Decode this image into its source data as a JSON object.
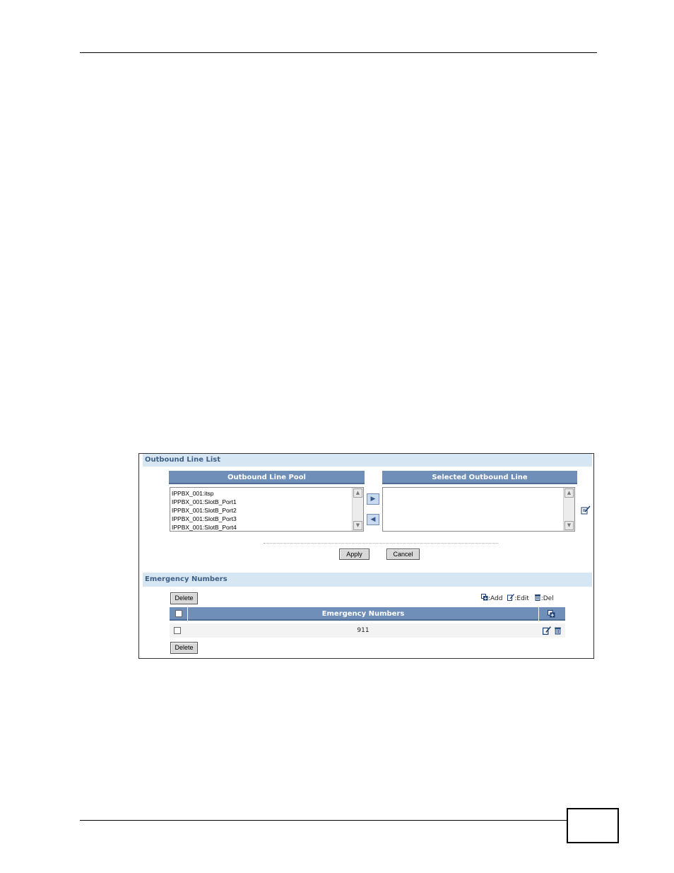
{
  "outbound": {
    "section_title": "Outbound Line List",
    "pool_header": "Outbound Line Pool",
    "selected_header": "Selected Outbound Line",
    "pool_items": [
      "IPPBX_001:itsp",
      "IPPBX_001:SlotB_Port1",
      "IPPBX_001:SlotB_Port2",
      "IPPBX_001:SlotB_Port3",
      "IPPBX_001:SlotB_Port4"
    ],
    "apply_label": "Apply",
    "cancel_label": "Cancel"
  },
  "emergency": {
    "section_title": "Emergency Numbers",
    "delete_label": "Delete",
    "legend_add": ":Add",
    "legend_edit": ":Edit",
    "legend_del": ":Del",
    "column_header": "Emergency Numbers",
    "rows": [
      {
        "number": "911"
      }
    ]
  },
  "colors": {
    "section_bg": "#d6e6f3",
    "header_bg": "#6f8eb8",
    "title_text": "#3f5f86"
  },
  "icons": [
    "scroll-up-icon",
    "scroll-down-icon",
    "move-right-icon",
    "move-left-icon",
    "edit-icon",
    "add-icon",
    "delete-icon"
  ]
}
